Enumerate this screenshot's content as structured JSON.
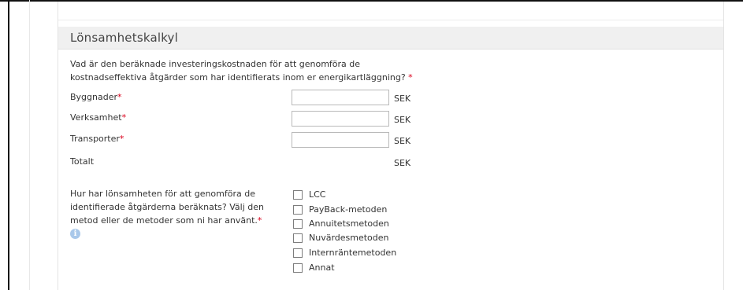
{
  "section": {
    "title": "Lönsamhetskalkyl"
  },
  "investment": {
    "question_line1": "Vad är den beräknade investeringskostnaden för att genomföra de",
    "question_line2": "kostnadseffektiva åtgärder som har identifierats inom er energikartläggning?",
    "required_mark": "*",
    "rows": [
      {
        "label": "Byggnader",
        "value": "",
        "unit": "SEK"
      },
      {
        "label": "Verksamhet",
        "value": "",
        "unit": "SEK"
      },
      {
        "label": "Transporter",
        "value": "",
        "unit": "SEK"
      }
    ],
    "total": {
      "label": "Totalt",
      "unit": "SEK"
    }
  },
  "methods": {
    "question_line1": "Hur har lönsamheten för att genomföra de",
    "question_line2": "identifierade åtgärderna beräknats? Välj den",
    "question_line3": "metod eller de metoder som ni har använt.",
    "required_mark": "*",
    "info_icon": "info-icon",
    "info_glyph": "i",
    "options": [
      {
        "label": "LCC",
        "checked": false
      },
      {
        "label": "PayBack-metoden",
        "checked": false
      },
      {
        "label": "Annuitetsmetoden",
        "checked": false
      },
      {
        "label": "Nuvärdesmetoden",
        "checked": false
      },
      {
        "label": "Internräntemetoden",
        "checked": false
      },
      {
        "label": "Annat",
        "checked": false
      }
    ]
  },
  "colors": {
    "required": "#d9001b",
    "header_bg": "#f0f0f0",
    "info_icon": "#a9c8ea"
  }
}
